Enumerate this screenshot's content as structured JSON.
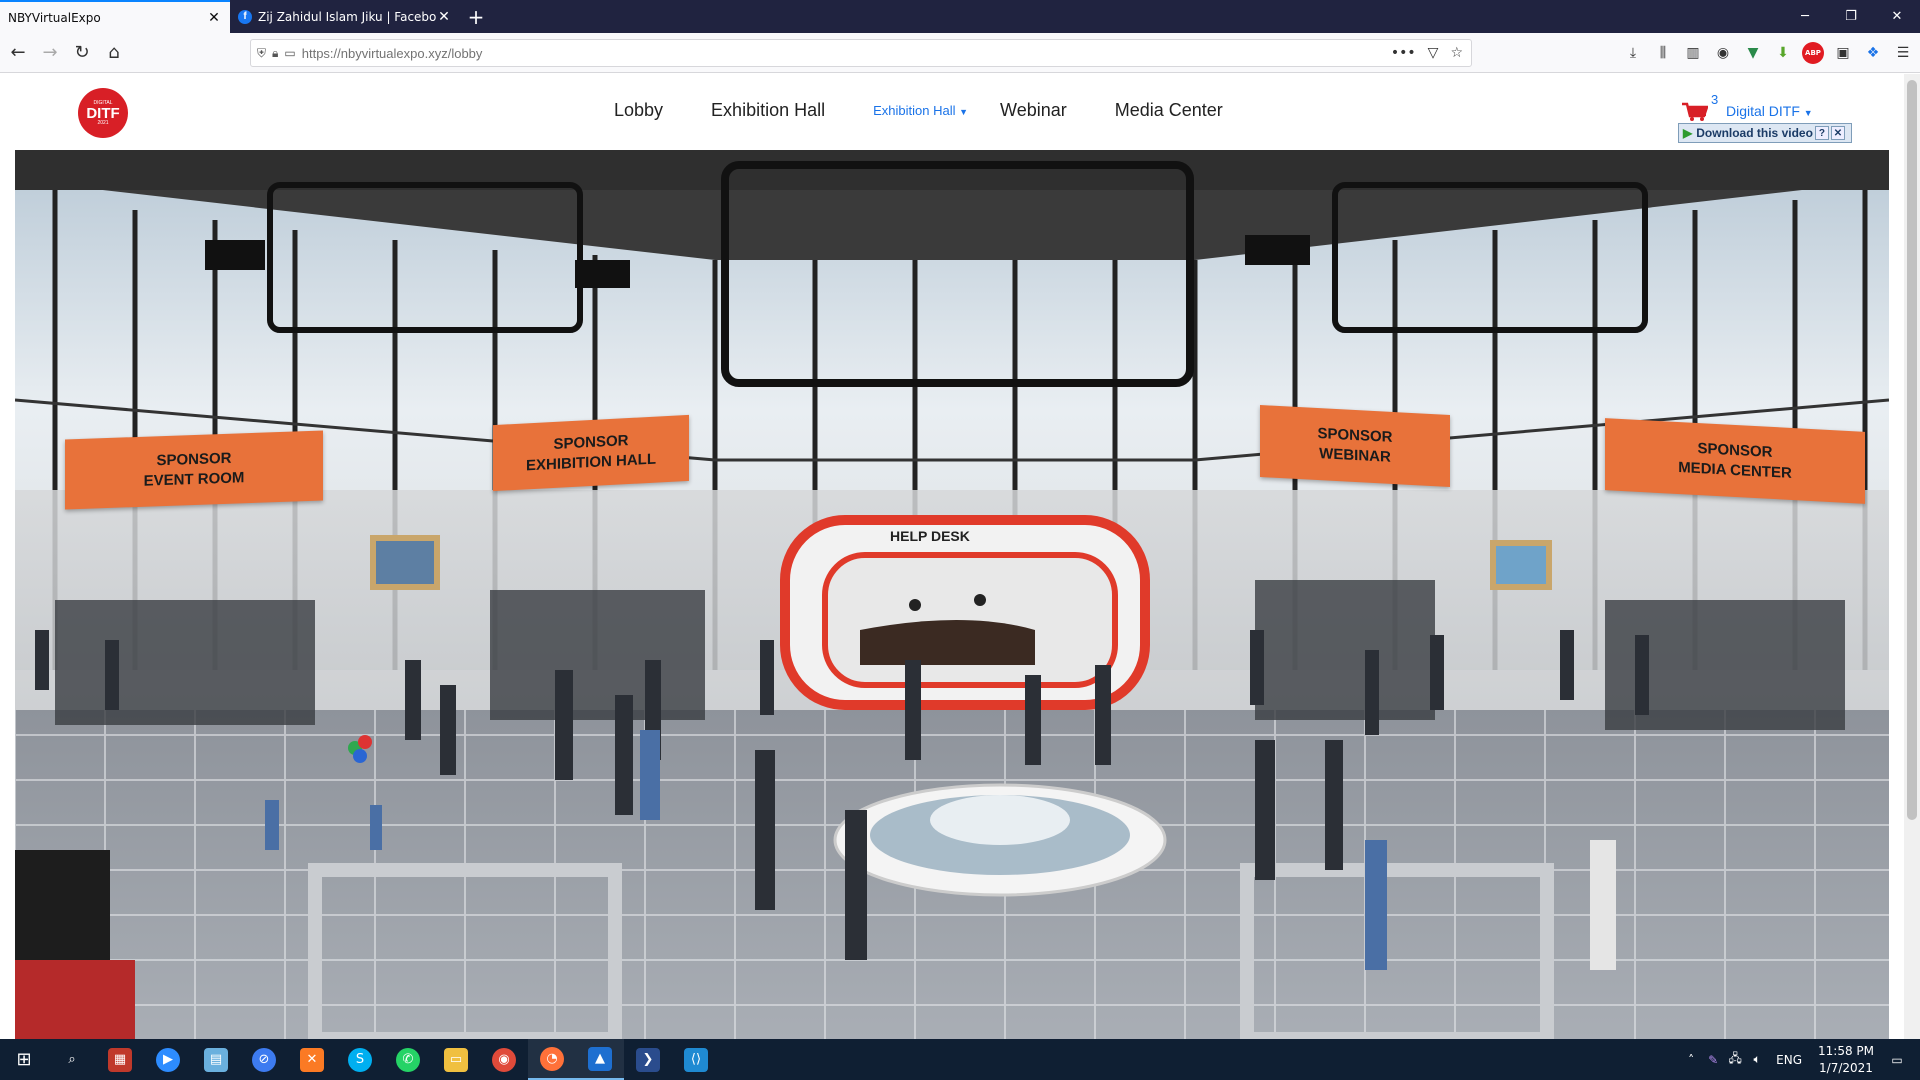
{
  "browser": {
    "tabs": [
      {
        "title": "NBYVirtualExpo",
        "active": true
      },
      {
        "title": "Zij Zahidul Islam Jiku | Faceboo",
        "active": false,
        "icon": "facebook-icon"
      }
    ],
    "new_tab_label": "+",
    "url": "https://nbyvirtualexpo.xyz/lobby",
    "url_more_label": "•••"
  },
  "site": {
    "logo": {
      "line1": "DIGITAL",
      "line2": "DITF",
      "line3": "2021"
    },
    "menu": [
      {
        "label": "Lobby"
      },
      {
        "label": "Exhibition Hall"
      },
      {
        "label": "Exhibition Hall",
        "dropdown": true
      },
      {
        "label": "Webinar"
      },
      {
        "label": "Media Center"
      }
    ],
    "cart_count": "3",
    "account_label": "Digital DITF",
    "download_video_label": "Download this video",
    "download_help_label": "?",
    "download_close_label": "✕"
  },
  "lobby": {
    "signs": [
      {
        "label": "SPONSOR\nEVENT ROOM"
      },
      {
        "label": "SPONSOR\nEXHIBITION HALL"
      },
      {
        "label": "SPONSOR\nWEBINAR"
      },
      {
        "label": "SPONSOR\nMEDIA CENTER"
      }
    ],
    "help_desk_label": "HELP DESK",
    "colors": {
      "sign": "#e8723a",
      "help_desk_frame": "#e03a2a",
      "floor": "#9aa0a8",
      "ceiling": "#2b2b2b"
    }
  },
  "taskbar": {
    "apps": [
      "start-icon",
      "search-icon",
      "paint-icon",
      "zoom-icon",
      "notepad-icon",
      "safari-icon",
      "xampp-icon",
      "skype-icon",
      "whatsapp-icon",
      "file-explorer-icon",
      "chrome-icon",
      "firefox-icon",
      "photos-icon",
      "powershell-icon",
      "vscode-icon"
    ],
    "language": "ENG",
    "time": "11:58 PM",
    "date": "1/7/2021"
  }
}
